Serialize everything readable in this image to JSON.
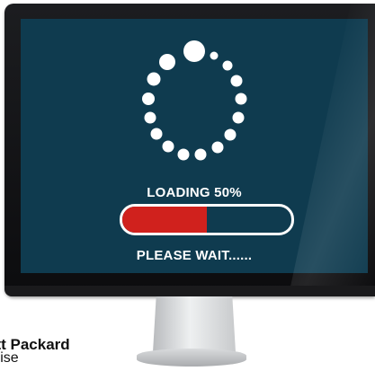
{
  "screen": {
    "loading_text": "LOADING 50%",
    "wait_text": "PLEASE WAIT......",
    "progress_fraction": 0.5
  },
  "brand": {
    "name": "ett Packard",
    "sub": "prise"
  },
  "colors": {
    "screen_bg": "#0f3b4f",
    "progress_fill": "#d0211d",
    "text": "#ffffff"
  },
  "icons": {
    "spinner": "loading-spinner-icon"
  }
}
